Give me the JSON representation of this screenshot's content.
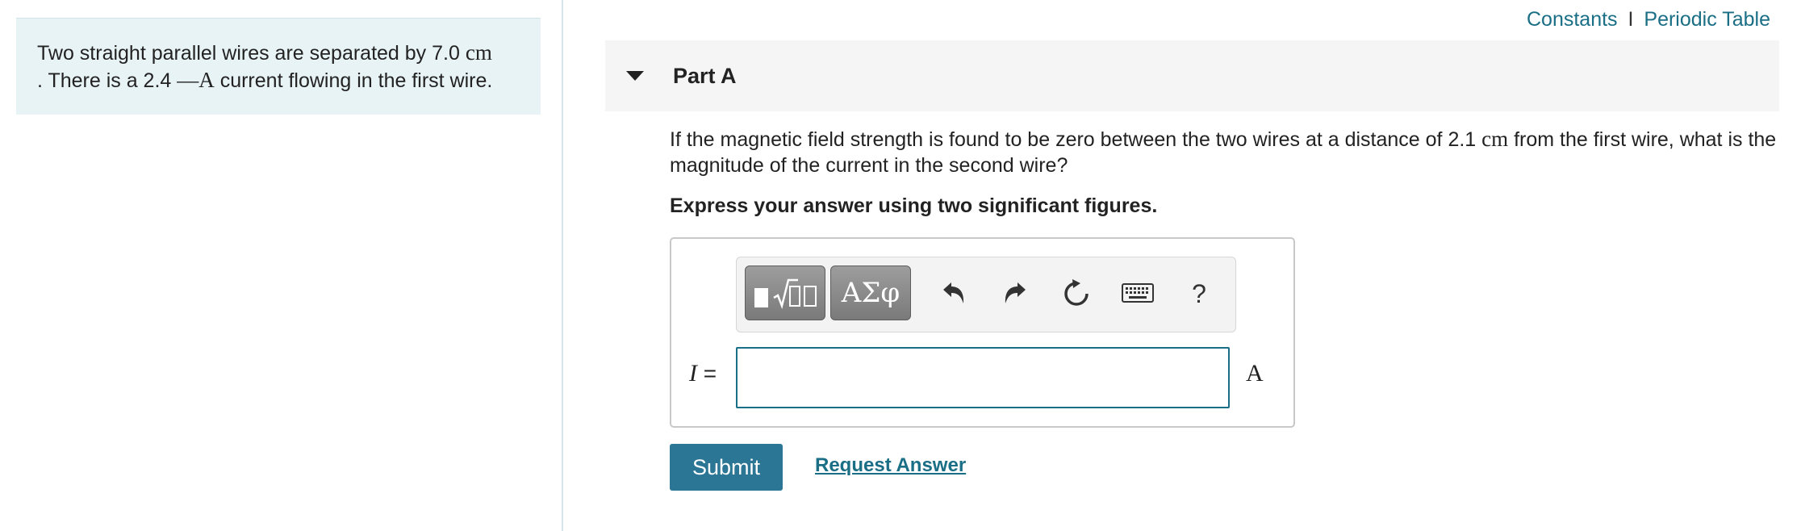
{
  "context": {
    "line1_text": "Two straight parallel wires are separated by 7.0",
    "line1_unit": "cm",
    "line2_prefix": ". There is a 2.4",
    "line2_unit": "—A",
    "line2_suffix": "current flowing in the first wire."
  },
  "header": {
    "constants_label": "Constants",
    "separator": "I",
    "periodic_table_label": "Periodic Table"
  },
  "part": {
    "title": "Part A"
  },
  "question": {
    "text_before_unit": "If the magnetic field strength is found to be zero between the two wires at a distance of 2.1",
    "unit": "cm",
    "text_after_unit": "from the first wire, what is the magnitude of the current in the second wire?"
  },
  "instruction": "Express your answer using two significant figures.",
  "toolbar": {
    "symbols_label": "ΑΣφ",
    "help_label": "?",
    "icons": [
      "templates-icon",
      "symbols-icon",
      "undo-icon",
      "redo-icon",
      "reset-icon",
      "keyboard-icon",
      "help-icon"
    ]
  },
  "answer": {
    "variable": "I",
    "equals": "=",
    "value": "",
    "unit": "A"
  },
  "actions": {
    "submit_label": "Submit",
    "request_answer_label": "Request Answer"
  },
  "colors": {
    "accent": "#1a6e85",
    "submit_bg": "#2b7595",
    "context_bg": "#e8f3f6",
    "part_header_bg": "#f5f5f5"
  }
}
